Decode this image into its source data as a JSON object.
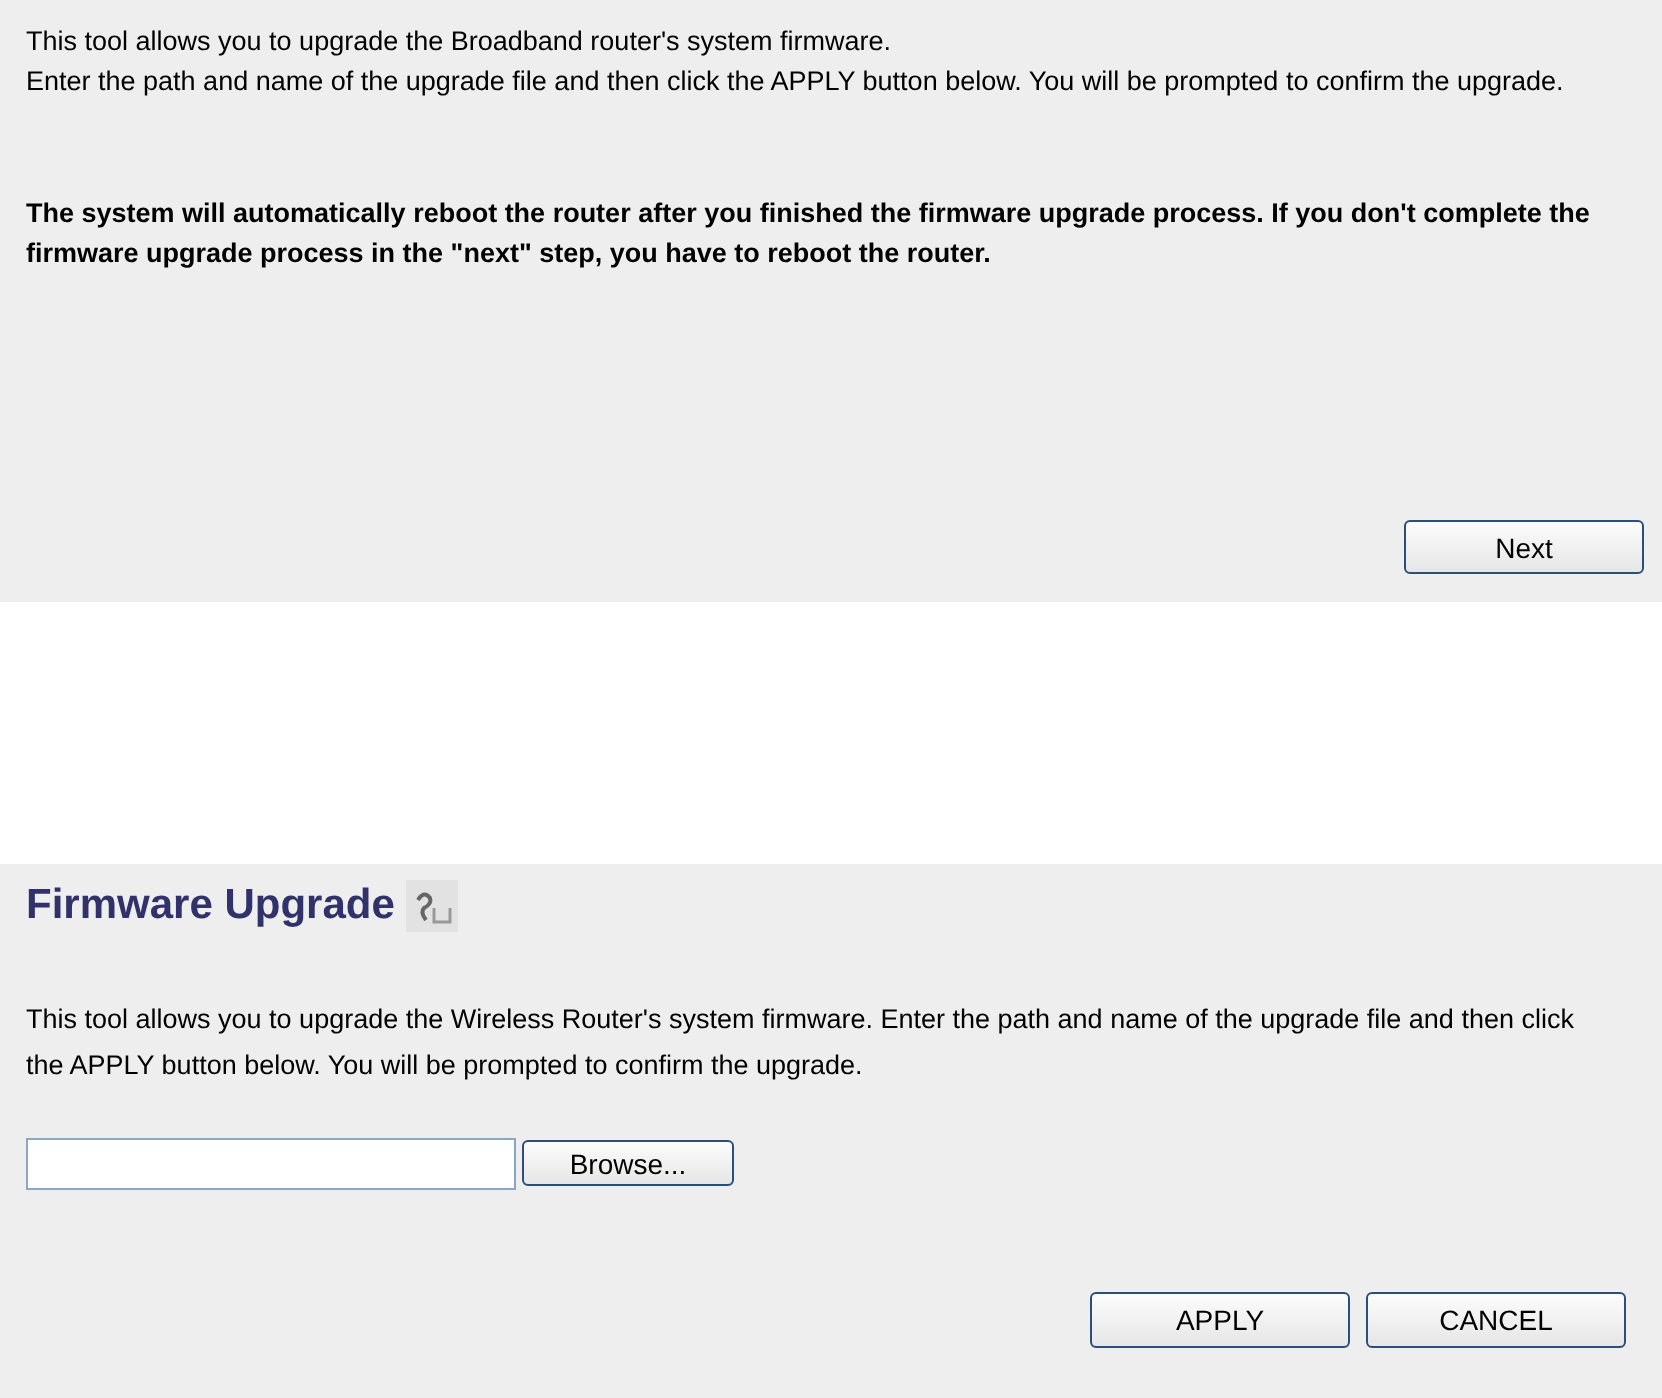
{
  "intro_panel": {
    "paragraphs": [
      "This tool allows you to upgrade the Broadband router's system firmware.",
      "Enter the path and name of the upgrade file and then click the APPLY button below. You will be prompted to confirm the upgrade."
    ],
    "warning": "The system will automatically reboot the router after you finished the firmware upgrade process. If you don't complete the firmware upgrade process in the \"next\" step, you have to reboot the router.",
    "next_button": "Next"
  },
  "upgrade_panel": {
    "title": "Firmware Upgrade",
    "description": "This tool allows you to upgrade the Wireless Router's system firmware. Enter the path and name of the upgrade file and then click the APPLY button below. You will be prompted to confirm the upgrade.",
    "browse_button": "Browse...",
    "buttons": [
      "APPLY",
      "CANCEL"
    ]
  }
}
